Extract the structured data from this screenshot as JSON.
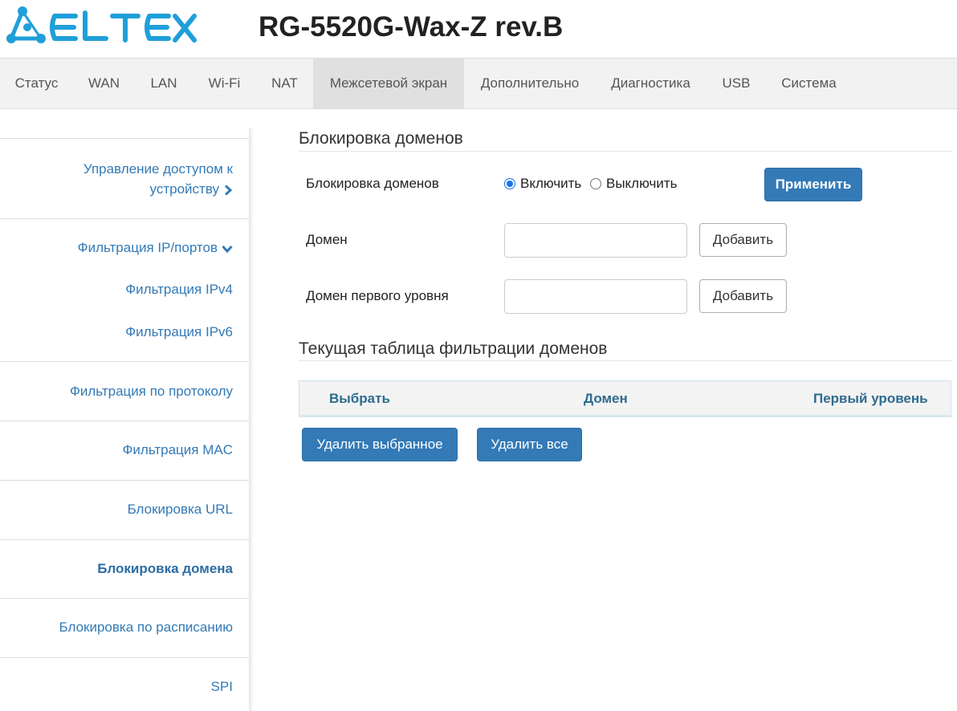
{
  "header": {
    "logo_text": "ELTEX",
    "device_title": "RG-5520G-Wax-Z rev.B",
    "brand_color": "#1f9fd9"
  },
  "topnav": {
    "items": [
      {
        "label": "Статус"
      },
      {
        "label": "WAN"
      },
      {
        "label": "LAN"
      },
      {
        "label": "Wi-Fi"
      },
      {
        "label": "NAT"
      },
      {
        "label": "Межсетевой экран",
        "active": true
      },
      {
        "label": "Дополнительно"
      },
      {
        "label": "Диагностика"
      },
      {
        "label": "USB"
      },
      {
        "label": "Система"
      }
    ]
  },
  "sidebar": {
    "access_line1": "Управление доступом к",
    "access_line2": "устройству",
    "items": [
      {
        "label": "Фильтрация IP/портов",
        "icon": "chevron-down-icon",
        "expanded": true
      },
      {
        "label": "Фильтрация IPv4"
      },
      {
        "label": "Фильтрация IPv6"
      },
      {
        "label": "Фильтрация по протоколу"
      },
      {
        "label": "Фильтрация MAC"
      },
      {
        "label": "Блокировка URL"
      },
      {
        "label": "Блокировка домена",
        "active": true
      },
      {
        "label": "Блокировка по расписанию"
      },
      {
        "label": "SPI"
      }
    ]
  },
  "main": {
    "section_title": "Блокировка доменов",
    "block_label": "Блокировка доменов",
    "radio_enable": "Включить",
    "radio_disable": "Выключить",
    "radio_selected": "Включить",
    "apply_button": "Применить",
    "domain_label": "Домен",
    "domain_value": "",
    "domain_add": "Добавить",
    "tld_label": "Домен первого уровня",
    "tld_value": "",
    "tld_add": "Добавить",
    "table_title": "Текущая таблица фильтрации доменов",
    "table_columns": [
      "Выбрать",
      "Домен",
      "Первый уровень"
    ],
    "table_rows": [],
    "delete_selected": "Удалить выбранное",
    "delete_all": "Удалить все"
  },
  "colors": {
    "primary_button": "#337ab7",
    "link": "#337ab7",
    "table_header_text": "#2e6b8f"
  }
}
